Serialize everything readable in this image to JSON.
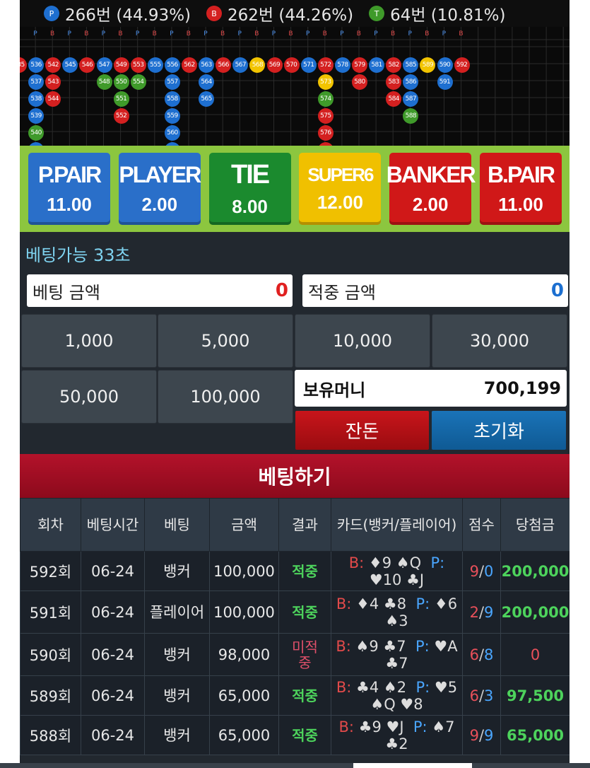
{
  "stats": [
    {
      "icon": "P",
      "color": "#1e6fd0",
      "text": "266번 (44.93%)"
    },
    {
      "icon": "B",
      "color": "#d42020",
      "text": "262번 (44.26%)"
    },
    {
      "icon": "T",
      "color": "#3f9a2a",
      "text": "64번 (10.81%)"
    }
  ],
  "road": {
    "headers": [
      "P",
      "B",
      "P",
      "B",
      "P",
      "B",
      "P",
      "B",
      "P",
      "B",
      "P",
      "B",
      "P",
      "B",
      "P",
      "B",
      "P",
      "B",
      "P",
      "B",
      "P",
      "B",
      "P",
      "B",
      "P",
      "B"
    ],
    "columns": [
      [
        {
          "n": "535",
          "c": "B"
        }
      ],
      [
        {
          "n": "536",
          "c": "P"
        },
        {
          "n": "537",
          "c": "P"
        },
        {
          "n": "538",
          "c": "P"
        },
        {
          "n": "539",
          "c": "P"
        },
        {
          "n": "540",
          "c": "T"
        },
        {
          "n": "541",
          "c": "P"
        }
      ],
      [
        {
          "n": "542",
          "c": "B"
        },
        {
          "n": "543",
          "c": "B"
        },
        {
          "n": "544",
          "c": "B"
        }
      ],
      [
        {
          "n": "545",
          "c": "P"
        }
      ],
      [
        {
          "n": "546",
          "c": "B"
        }
      ],
      [
        {
          "n": "547",
          "c": "P"
        },
        {
          "n": "548",
          "c": "T"
        }
      ],
      [
        {
          "n": "549",
          "c": "B"
        },
        {
          "n": "550",
          "c": "T"
        },
        {
          "n": "551",
          "c": "T"
        },
        {
          "n": "552",
          "c": "B"
        }
      ],
      [
        {
          "n": "553",
          "c": "B"
        },
        {
          "n": "554",
          "c": "T"
        }
      ],
      [
        {
          "n": "555",
          "c": "P"
        }
      ],
      [
        {
          "n": "556",
          "c": "P"
        },
        {
          "n": "557",
          "c": "P"
        },
        {
          "n": "558",
          "c": "P"
        },
        {
          "n": "559",
          "c": "P"
        },
        {
          "n": "560",
          "c": "P"
        },
        {
          "n": "561",
          "c": "P"
        }
      ],
      [
        {
          "n": "562",
          "c": "B"
        }
      ],
      [
        {
          "n": "563",
          "c": "P"
        },
        {
          "n": "564",
          "c": "P"
        },
        {
          "n": "565",
          "c": "P"
        }
      ],
      [
        {
          "n": "566",
          "c": "B"
        }
      ],
      [
        {
          "n": "567",
          "c": "P"
        }
      ],
      [
        {
          "n": "568",
          "c": "S"
        }
      ],
      [
        {
          "n": "569",
          "c": "B"
        }
      ],
      [
        {
          "n": "570",
          "c": "B"
        }
      ],
      [
        {
          "n": "571",
          "c": "P"
        }
      ],
      [
        {
          "n": "572",
          "c": "B"
        },
        {
          "n": "573",
          "c": "S"
        },
        {
          "n": "574",
          "c": "T"
        },
        {
          "n": "575",
          "c": "B"
        },
        {
          "n": "576",
          "c": "B"
        },
        {
          "n": "577",
          "c": "B"
        }
      ],
      [
        {
          "n": "578",
          "c": "P"
        }
      ],
      [
        {
          "n": "579",
          "c": "B"
        },
        {
          "n": "580",
          "c": "B"
        }
      ],
      [
        {
          "n": "581",
          "c": "P"
        }
      ],
      [
        {
          "n": "582",
          "c": "B"
        },
        {
          "n": "583",
          "c": "B"
        },
        {
          "n": "584",
          "c": "B"
        }
      ],
      [
        {
          "n": "585",
          "c": "P"
        },
        {
          "n": "586",
          "c": "P"
        },
        {
          "n": "587",
          "c": "P"
        },
        {
          "n": "588",
          "c": "T"
        }
      ],
      [
        {
          "n": "589",
          "c": "S"
        }
      ],
      [
        {
          "n": "590",
          "c": "P"
        },
        {
          "n": "591",
          "c": "P"
        }
      ],
      [
        {
          "n": "592",
          "c": "B"
        }
      ]
    ],
    "colors": {
      "P": "#1e6fd0",
      "B": "#d42020",
      "T": "#3f9a2a",
      "S": "#f2c400"
    }
  },
  "bets": [
    {
      "name": "P.PAIR",
      "odds": "11.00",
      "color": "#2a6fc9"
    },
    {
      "name": "PLAYER",
      "odds": "2.00",
      "color": "#2a6fc9"
    },
    {
      "name": "TIE",
      "odds": "8.00",
      "color": "#1b8a2e"
    },
    {
      "name": "SUPER6",
      "odds": "12.00",
      "color": "#f0c000"
    },
    {
      "name": "BANKER",
      "odds": "2.00",
      "color": "#d01818"
    },
    {
      "name": "B.PAIR",
      "odds": "11.00",
      "color": "#d01818"
    }
  ],
  "timer": "베팅가능 33초",
  "bet_amount": {
    "label": "베팅 금액",
    "value": "0"
  },
  "win_amount": {
    "label": "적중 금액",
    "value": "0"
  },
  "chips": [
    "1,000",
    "5,000",
    "10,000",
    "30,000",
    "50,000",
    "100,000"
  ],
  "balance": {
    "label": "보유머니",
    "value": "700,199"
  },
  "change_button": "잔돈",
  "reset_button": "초기화",
  "bet_button": "베팅하기",
  "history": {
    "headers": [
      "회차",
      "베팅시간",
      "베팅",
      "금액",
      "결과",
      "카드(뱅커/플레이어)",
      "점수",
      "당첨금"
    ],
    "rows": [
      {
        "round": "592회",
        "date": "06-24",
        "bet": "뱅커",
        "amount": "100,000",
        "result": "적중",
        "win": true,
        "bcards": "B: ♦9 ♠Q",
        "pcards": "P: ♥10 ♣J",
        "bscore": "9",
        "pscore": "0",
        "prize": "200,000"
      },
      {
        "round": "591회",
        "date": "06-24",
        "bet": "플레이어",
        "amount": "100,000",
        "result": "적중",
        "win": true,
        "bcards": "B: ♦4 ♣8",
        "pcards": "P: ♦6 ♠3",
        "bscore": "2",
        "pscore": "9",
        "prize": "200,000"
      },
      {
        "round": "590회",
        "date": "06-24",
        "bet": "뱅커",
        "amount": "98,000",
        "result": "미적중",
        "win": false,
        "bcards": "B: ♠9 ♣7",
        "pcards": "P: ♥A ♣7",
        "bscore": "6",
        "pscore": "8",
        "prize": "0"
      },
      {
        "round": "589회",
        "date": "06-24",
        "bet": "뱅커",
        "amount": "65,000",
        "result": "적중",
        "win": true,
        "bcards": "B: ♣4 ♠2",
        "pcards": "P: ♥5 ♠Q ♥8",
        "bscore": "6",
        "pscore": "3",
        "prize": "97,500"
      },
      {
        "round": "588회",
        "date": "06-24",
        "bet": "뱅커",
        "amount": "65,000",
        "result": "적중",
        "win": true,
        "bcards": "B: ♣9 ♥J",
        "pcards": "P: ♠7 ♣2",
        "bscore": "9",
        "pscore": "9",
        "prize": "65,000"
      }
    ]
  }
}
